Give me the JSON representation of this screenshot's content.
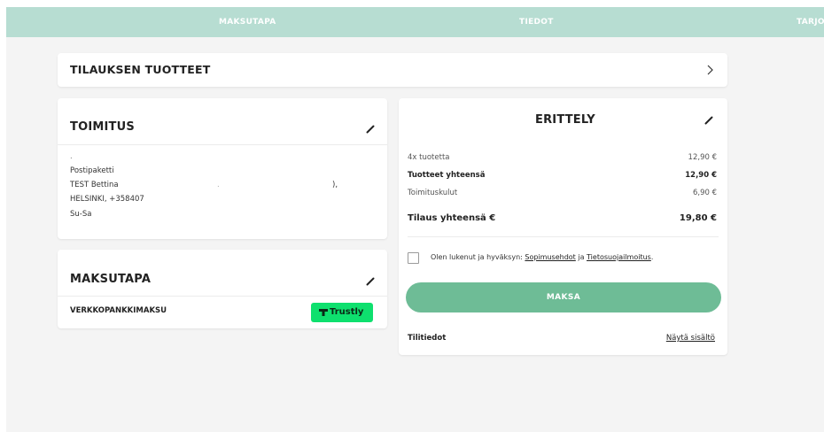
{
  "steps": [
    {
      "label": "MAKSUTAPA"
    },
    {
      "label": "TIEDOT"
    },
    {
      "label": "TARJO"
    }
  ],
  "products": {
    "title": "TILAUKSEN TUOTTEET",
    "chevron": "chevron-right-icon"
  },
  "delivery": {
    "title": "TOIMITUS",
    "dot": ".",
    "method": "Postipaketti",
    "name": "TEST Bettina",
    "masked_mid": ".",
    "masked_end": "),",
    "city_phone": "HELSINKI, +358407",
    "days": "Su-Sa"
  },
  "payment": {
    "title": "MAKSUTAPA",
    "method": "VERKKOPANKKIMAKSU",
    "provider": "Trustly",
    "provider_color": "#0ee06e"
  },
  "summary": {
    "title": "ERITTELY",
    "rows": [
      {
        "label": "4x tuotetta",
        "value": "12,90 €"
      },
      {
        "label": "Tuotteet yhteensä",
        "value": "12,90 €"
      },
      {
        "label": "Toimituskulut",
        "value": "6,90 €"
      },
      {
        "label": "Tilaus yhteensä €",
        "value": "19,80 €"
      }
    ],
    "terms_prefix": "Olen lukenut ja hyväksyn:",
    "terms_link": "Sopimusehdot",
    "terms_and": "ja",
    "privacy_link": "Tietosuojailmoitus",
    "terms_suffix": ".",
    "pay_label": "MAKSA",
    "pay_color": "#6ebc96",
    "account_label": "Tilitiedot",
    "account_link": "Näytä sisältö"
  }
}
